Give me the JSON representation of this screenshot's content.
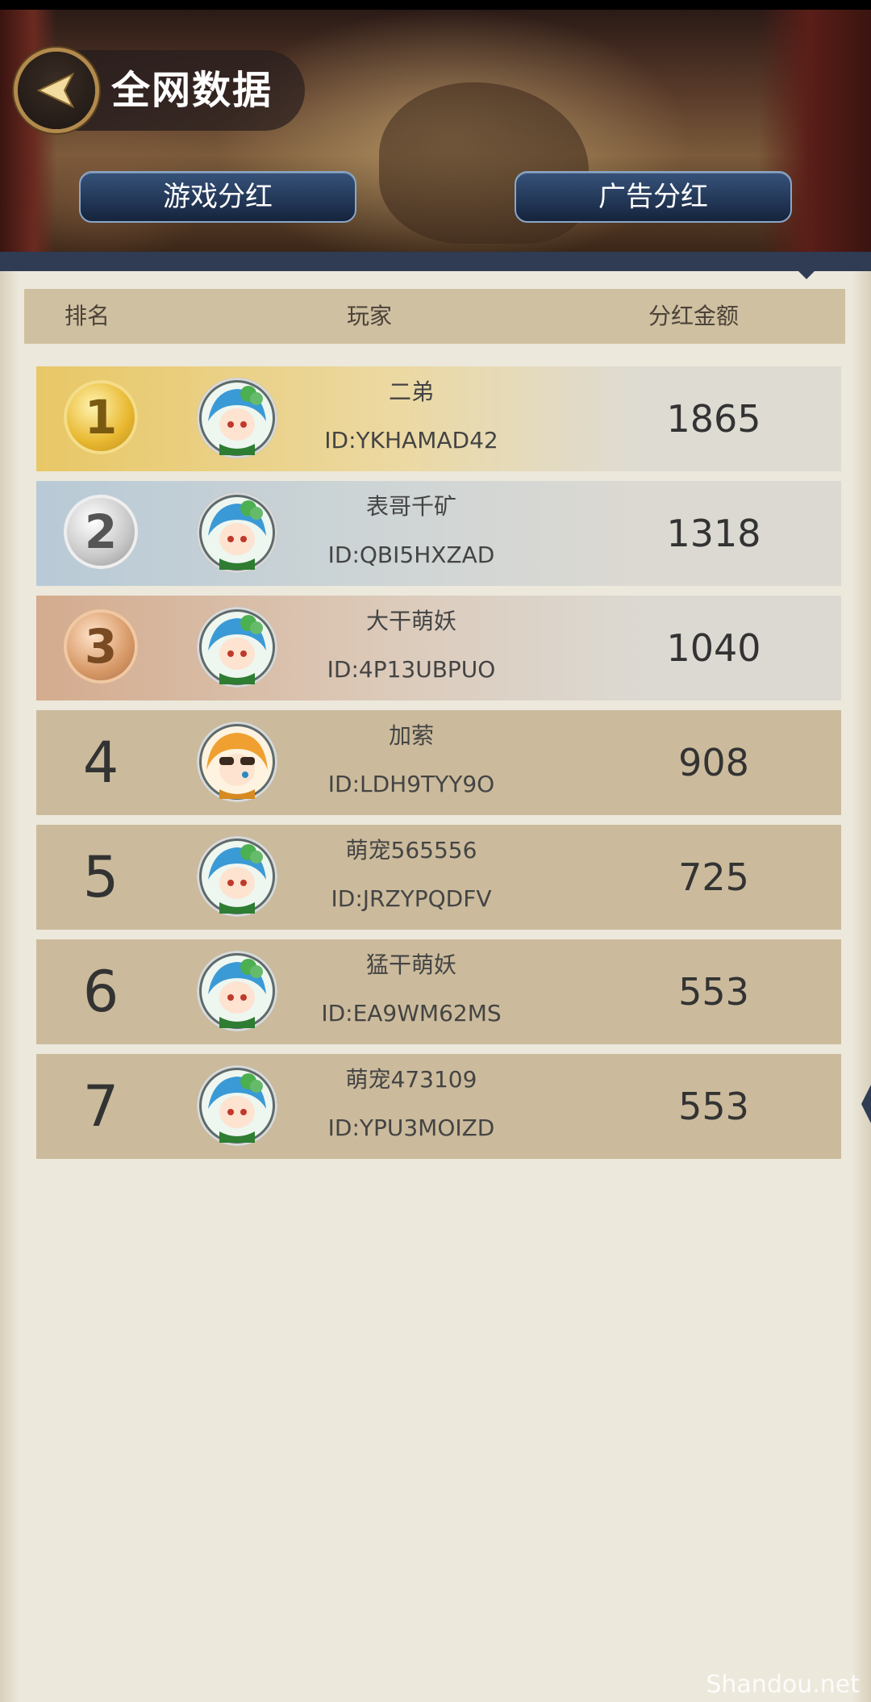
{
  "header": {
    "title": "全网数据",
    "back_icon": "back-arrow-icon",
    "tabs": [
      {
        "label": "游戏分红"
      },
      {
        "label": "广告分红"
      }
    ]
  },
  "table": {
    "columns": {
      "rank": "排名",
      "player": "玩家",
      "amount": "分红金额"
    },
    "rows": [
      {
        "rank": "1",
        "name": "二弟",
        "id": "ID:YKHAMAD42",
        "amount": "1865",
        "avatar": "green-hair-girl-avatar"
      },
      {
        "rank": "2",
        "name": "表哥千矿",
        "id": "ID:QBI5HXZAD",
        "amount": "1318",
        "avatar": "green-hair-girl-avatar"
      },
      {
        "rank": "3",
        "name": "大干萌妖",
        "id": "ID:4P13UBPUO",
        "amount": "1040",
        "avatar": "green-hair-girl-avatar"
      },
      {
        "rank": "4",
        "name": "加萦",
        "id": "ID:LDH9TYY9O",
        "amount": "908",
        "avatar": "orange-hair-sunglasses-avatar"
      },
      {
        "rank": "5",
        "name": "萌宠565556",
        "id": "ID:JRZYPQDFV",
        "amount": "725",
        "avatar": "green-hair-girl-avatar"
      },
      {
        "rank": "6",
        "name": "猛干萌妖",
        "id": "ID:EA9WM62MS",
        "amount": "553",
        "avatar": "green-hair-girl-avatar"
      },
      {
        "rank": "7",
        "name": "萌宠473109",
        "id": "ID:YPU3MOIZD",
        "amount": "553",
        "avatar": "green-hair-girl-avatar"
      }
    ]
  },
  "watermark": "Shandou.net"
}
